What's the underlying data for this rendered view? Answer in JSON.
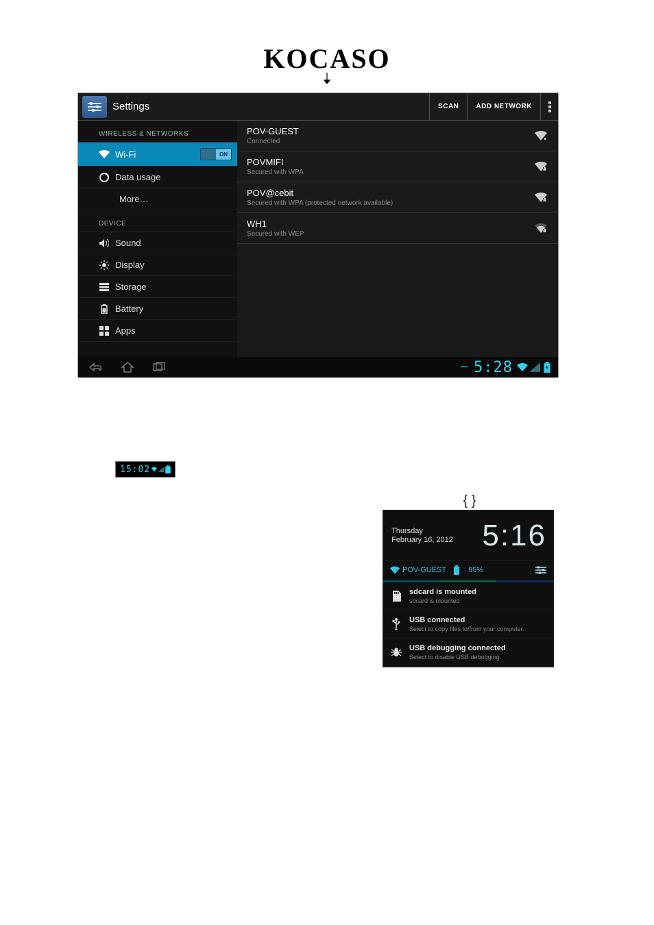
{
  "brand": "KOCASO",
  "settings": {
    "title": "Settings",
    "actions": {
      "scan": "SCAN",
      "add_network": "ADD NETWORK"
    },
    "sections": {
      "wireless_header": "WIRELESS & NETWORKS",
      "device_header": "DEVICE"
    },
    "sidebar": {
      "wifi": {
        "label": "Wi-Fi",
        "toggle": "ON"
      },
      "data_usage": {
        "label": "Data usage"
      },
      "more": {
        "label": "More…"
      },
      "sound": {
        "label": "Sound"
      },
      "display": {
        "label": "Display"
      },
      "storage": {
        "label": "Storage"
      },
      "battery": {
        "label": "Battery"
      },
      "apps": {
        "label": "Apps"
      }
    },
    "networks": [
      {
        "ssid": "POV-GUEST",
        "sub": "Connected"
      },
      {
        "ssid": "POVMIFI",
        "sub": "Secured with WPA"
      },
      {
        "ssid": "POV@cebit",
        "sub": "Secured with WPA (protected network available)"
      },
      {
        "ssid": "WH1",
        "sub": "Secured with WEP"
      }
    ],
    "navbar_clock": "5:28"
  },
  "pill": {
    "time": "15:02"
  },
  "braces": "{ }",
  "pulldown": {
    "day": "Thursday",
    "date": "February 16, 2012",
    "time": "5:16",
    "wifi_name": "POV-GUEST",
    "battery": "95%",
    "notifications": [
      {
        "title": "sdcard is mounted",
        "sub": "sdcard is mounted"
      },
      {
        "title": "USB connected",
        "sub": "Select to copy files to/from your computer."
      },
      {
        "title": "USB debugging connected",
        "sub": "Select to disable USB debugging."
      }
    ]
  }
}
